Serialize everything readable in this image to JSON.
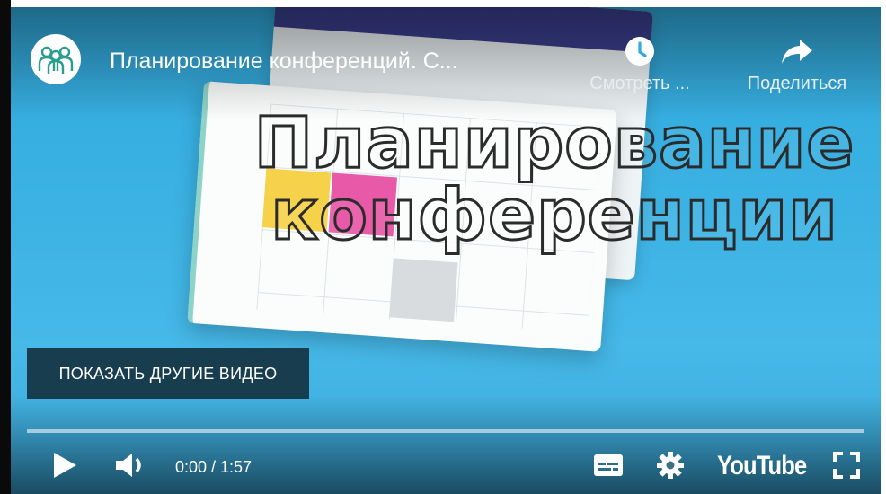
{
  "video": {
    "title": "Планирование конференций. С...",
    "overlay_line1": "Планирование",
    "overlay_line2": "конференции"
  },
  "header": {
    "watch_later_label": "Смотреть ...",
    "share_label": "Поделиться"
  },
  "more_videos_label": "ПОКАЗАТЬ ДРУГИЕ ВИДЕО",
  "controls": {
    "time_display": "0:00 / 1:57",
    "progress": 0,
    "brand": "YouTube"
  },
  "icons": {
    "channel": "people-group-icon",
    "watch_later": "clock-icon",
    "share": "share-arrow-icon",
    "play": "play-icon",
    "volume": "volume-icon",
    "subtitles": "subtitles-icon",
    "settings": "gear-icon",
    "fullscreen": "fullscreen-icon"
  },
  "colors": {
    "background": "#3bb2e3",
    "button_bg": "#183d4e",
    "logo_accent": "#2a9d8f"
  }
}
